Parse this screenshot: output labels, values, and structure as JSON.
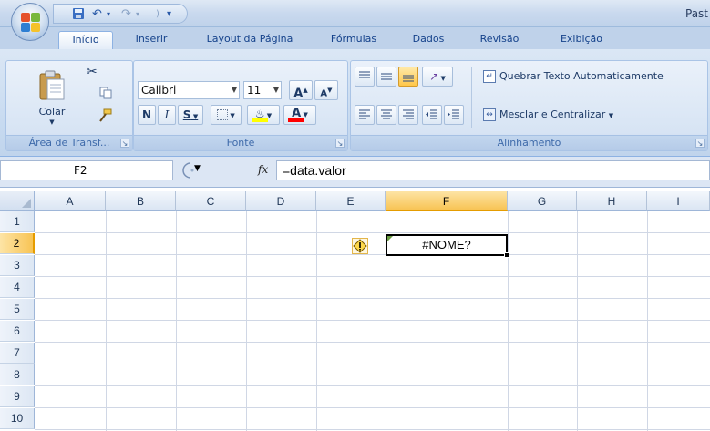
{
  "window": {
    "title": "Past"
  },
  "tabs": [
    {
      "label": "Início",
      "active": true
    },
    {
      "label": "Inserir"
    },
    {
      "label": "Layout da Página"
    },
    {
      "label": "Fórmulas"
    },
    {
      "label": "Dados"
    },
    {
      "label": "Revisão"
    },
    {
      "label": "Exibição"
    }
  ],
  "ribbon": {
    "clipboard": {
      "label": "Área de Transf...",
      "paste_label": "Colar"
    },
    "font": {
      "label": "Fonte",
      "family": "Calibri",
      "size": "11",
      "grow": "A",
      "shrink": "A",
      "bold": "N",
      "italic": "I",
      "underline": "S",
      "color_letter": "A",
      "font_color": "#ff0000",
      "fill_color": "#ffff00"
    },
    "alignment": {
      "label": "Alinhamento",
      "wrap_text": "Quebrar Texto Automaticamente",
      "merge_center": "Mesclar e Centralizar"
    }
  },
  "formula_bar": {
    "name_box": "F2",
    "fx": "fx",
    "formula": "=data.valor"
  },
  "grid": {
    "columns": [
      "A",
      "B",
      "C",
      "D",
      "E",
      "F",
      "G",
      "H",
      "I"
    ],
    "rows": [
      "1",
      "2",
      "3",
      "4",
      "5",
      "6",
      "7",
      "8",
      "9",
      "10"
    ],
    "selected_column": "F",
    "selected_row": "2",
    "active_cell": {
      "ref": "F2",
      "value": "#NOME?"
    }
  },
  "colors": {
    "accent": "#15428b",
    "selection": "#f8c455",
    "error_indicator": "#6a9c43"
  }
}
